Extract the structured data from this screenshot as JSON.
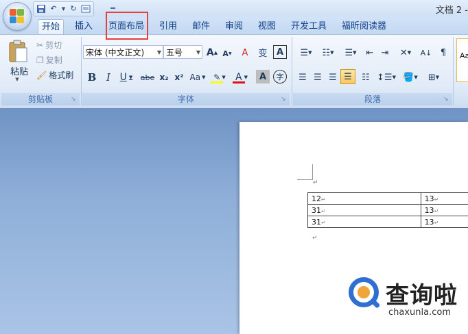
{
  "title_bar": {
    "doc_title": "文档 2 -",
    "qat_icons": [
      "save-icon",
      "undo-icon",
      "dropdown-arrow-icon",
      "redo-icon",
      "print-preview-icon"
    ],
    "qat_more": "="
  },
  "tabs": [
    {
      "label": "开始",
      "active": true
    },
    {
      "label": "插入"
    },
    {
      "label": "页面布局",
      "highlighted": true
    },
    {
      "label": "引用"
    },
    {
      "label": "邮件"
    },
    {
      "label": "审阅"
    },
    {
      "label": "视图"
    },
    {
      "label": "开发工具"
    },
    {
      "label": "福昕阅读器"
    }
  ],
  "clipboard": {
    "paste": "粘贴",
    "cut": "剪切",
    "copy": "复制",
    "format_painter": "格式刷",
    "group": "剪贴板"
  },
  "font": {
    "name": "宋体 (中文正文)",
    "size": "五号",
    "bold": "B",
    "italic": "I",
    "underline": "U",
    "strike": "abe",
    "subscript": "x₂",
    "superscript": "x²",
    "change_case": "Aa",
    "grow": "A",
    "shrink": "A",
    "clear": "A",
    "font_color": "A",
    "char_shade": "A",
    "enclose": "字",
    "phonetic": "变",
    "border": "A",
    "group": "字体",
    "highlight_color": "#ffff00",
    "font_color_value": "#e01010"
  },
  "paragraph": {
    "group": "段落"
  },
  "styles": {
    "preview": "Aa"
  },
  "table": {
    "rows": [
      [
        "12",
        "13"
      ],
      [
        "31",
        "13"
      ],
      [
        "31",
        "13"
      ]
    ]
  },
  "watermark": {
    "text": "查询啦",
    "url": "chaxunla.com"
  }
}
